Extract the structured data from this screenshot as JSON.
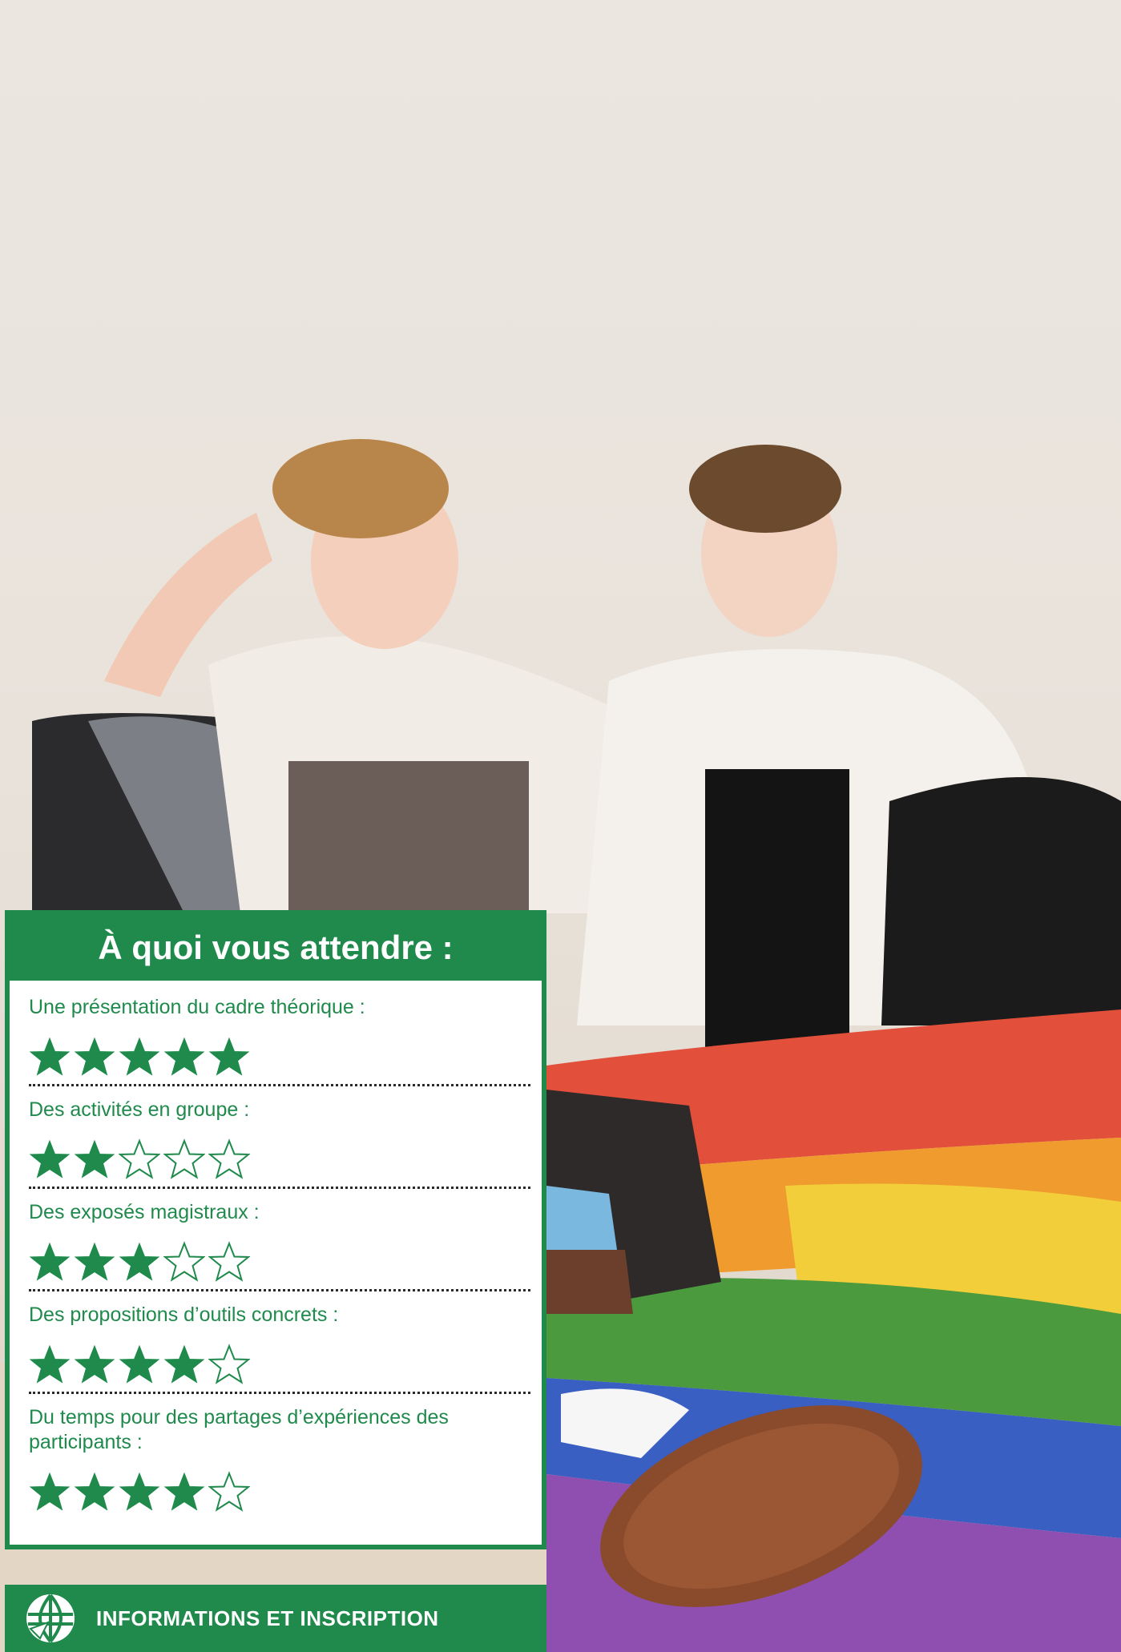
{
  "photo": {
    "description_icon": "people-photo"
  },
  "panel": {
    "title": "À quoi vous attendre :",
    "items": [
      {
        "label": "Une présentation du cadre théorique :",
        "rating": 5,
        "max": 5
      },
      {
        "label": "Des activités en groupe :",
        "rating": 2,
        "max": 5
      },
      {
        "label": "Des exposés magistraux :",
        "rating": 3,
        "max": 5
      },
      {
        "label": "Des propositions d’outils concrets :",
        "rating": 4,
        "max": 5
      },
      {
        "label": "Du temps pour des partages d’expériences des participants :",
        "rating": 4,
        "max": 5
      }
    ]
  },
  "info_bar": {
    "label": "INFORMATIONS ET INSCRIPTION",
    "icon": "globe-icon"
  },
  "colors": {
    "accent": "#1f8a4c",
    "text_on_accent": "#ffffff"
  }
}
